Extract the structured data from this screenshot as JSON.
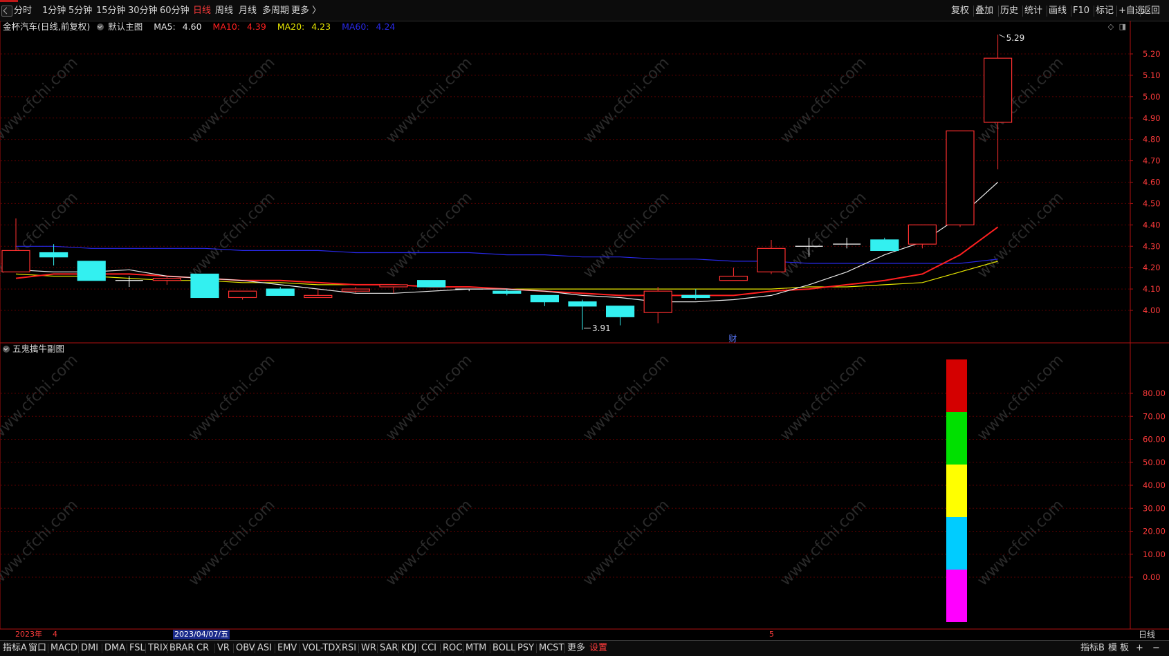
{
  "toolbar": {
    "periods": [
      {
        "label": "分时",
        "active": false
      },
      {
        "label": "1分钟",
        "active": false
      },
      {
        "label": "5分钟",
        "active": false
      },
      {
        "label": "15分钟",
        "active": false
      },
      {
        "label": "30分钟",
        "active": false
      },
      {
        "label": "60分钟",
        "active": false
      },
      {
        "label": "日线",
        "active": true
      },
      {
        "label": "周线",
        "active": false
      },
      {
        "label": "月线",
        "active": false
      },
      {
        "label": "多周期",
        "active": false
      },
      {
        "label": "更多 〉",
        "active": false
      }
    ],
    "tools": [
      "复权",
      "叠加",
      "历史",
      "统计",
      "画线",
      "F10",
      "标记",
      "+自选",
      "返回"
    ]
  },
  "main_chart": {
    "stock_name": "金杯汽车(日线,前复权)",
    "template_label": "默认主图",
    "ma5": {
      "label": "MA5:",
      "value": "4.60",
      "color": "#e8e8e8"
    },
    "ma10": {
      "label": "MA10:",
      "value": "4.39",
      "color": "#ff2020"
    },
    "ma20": {
      "label": "MA20:",
      "value": "4.23",
      "color": "#e8e800"
    },
    "ma60": {
      "label": "MA60:",
      "value": "4.24",
      "color": "#2828e8"
    },
    "high_marker": "5.29",
    "low_marker": "3.91",
    "event_marker": "财",
    "price_ticks": [
      "5.20",
      "5.10",
      "5.00",
      "4.90",
      "4.80",
      "4.70",
      "4.60",
      "4.50",
      "4.40",
      "4.30",
      "4.20",
      "4.10",
      "4.00"
    ]
  },
  "sub_chart": {
    "title": "五鬼擒牛副图",
    "ticks": [
      "80.00",
      "70.00",
      "60.00",
      "50.00",
      "40.00",
      "30.00",
      "20.00",
      "10.00",
      "0.00"
    ]
  },
  "time_axis": {
    "year_label": "2023年",
    "month_start": "4",
    "cursor_date": "2023/04/07/五",
    "month_next": "5",
    "period_label": "日线"
  },
  "bottom_tabs": {
    "indicator_a": "指标A",
    "window": "窗口",
    "indicators": [
      "MACD",
      "DMI",
      "DMA",
      "FSL",
      "TRIX",
      "BRAR",
      "CR",
      "VR",
      "OBV",
      "ASI",
      "EMV",
      "VOL-TDX",
      "RSI",
      "WR",
      "SAR",
      "KDJ",
      "CCI",
      "ROC",
      "MTM",
      "BOLL",
      "PSY",
      "MCST",
      "更多"
    ],
    "settings": "设置",
    "indicator_b": "指标B",
    "board": "模 板",
    "plus": "+",
    "minus": "−"
  },
  "watermark": "www.cfchi.com",
  "chart_data": {
    "type": "candlestick",
    "price_range": [
      3.9,
      5.3
    ],
    "candles": [
      {
        "o": 4.28,
        "h": 4.43,
        "l": 4.18,
        "c": 4.18,
        "dir": "up"
      },
      {
        "o": 4.27,
        "h": 4.31,
        "l": 4.21,
        "c": 4.25,
        "dir": "down"
      },
      {
        "o": 4.23,
        "h": 4.23,
        "l": 4.14,
        "c": 4.14,
        "dir": "down"
      },
      {
        "o": 4.14,
        "h": 4.16,
        "l": 4.11,
        "c": 4.14,
        "dir": "doji"
      },
      {
        "o": 4.14,
        "h": 4.16,
        "l": 4.12,
        "c": 4.15,
        "dir": "up"
      },
      {
        "o": 4.17,
        "h": 4.17,
        "l": 4.06,
        "c": 4.06,
        "dir": "down"
      },
      {
        "o": 4.06,
        "h": 4.09,
        "l": 4.05,
        "c": 4.09,
        "dir": "up"
      },
      {
        "o": 4.1,
        "h": 4.11,
        "l": 4.07,
        "c": 4.07,
        "dir": "down"
      },
      {
        "o": 4.06,
        "h": 4.1,
        "l": 4.06,
        "c": 4.07,
        "dir": "up"
      },
      {
        "o": 4.1,
        "h": 4.11,
        "l": 4.08,
        "c": 4.09,
        "dir": "up"
      },
      {
        "o": 4.11,
        "h": 4.12,
        "l": 4.08,
        "c": 4.12,
        "dir": "up"
      },
      {
        "o": 4.14,
        "h": 4.14,
        "l": 4.11,
        "c": 4.11,
        "dir": "down"
      },
      {
        "o": 4.1,
        "h": 4.1,
        "l": 4.09,
        "c": 4.1,
        "dir": "doji"
      },
      {
        "o": 4.09,
        "h": 4.1,
        "l": 4.07,
        "c": 4.08,
        "dir": "down"
      },
      {
        "o": 4.07,
        "h": 4.07,
        "l": 4.02,
        "c": 4.04,
        "dir": "down"
      },
      {
        "o": 4.04,
        "h": 4.05,
        "l": 3.91,
        "c": 4.02,
        "dir": "down"
      },
      {
        "o": 4.02,
        "h": 4.02,
        "l": 3.93,
        "c": 3.97,
        "dir": "down"
      },
      {
        "o": 3.99,
        "h": 4.11,
        "l": 3.94,
        "c": 4.09,
        "dir": "up"
      },
      {
        "o": 4.07,
        "h": 4.1,
        "l": 4.05,
        "c": 4.06,
        "dir": "down"
      },
      {
        "o": 4.14,
        "h": 4.2,
        "l": 4.14,
        "c": 4.16,
        "dir": "up"
      },
      {
        "o": 4.18,
        "h": 4.33,
        "l": 4.17,
        "c": 4.29,
        "dir": "up"
      },
      {
        "o": 4.3,
        "h": 4.34,
        "l": 4.25,
        "c": 4.3,
        "dir": "doji"
      },
      {
        "o": 4.31,
        "h": 4.34,
        "l": 4.29,
        "c": 4.31,
        "dir": "doji"
      },
      {
        "o": 4.33,
        "h": 4.34,
        "l": 4.28,
        "c": 4.28,
        "dir": "down"
      },
      {
        "o": 4.31,
        "h": 4.4,
        "l": 4.29,
        "c": 4.4,
        "dir": "up"
      },
      {
        "o": 4.4,
        "h": 4.84,
        "l": 4.39,
        "c": 4.84,
        "dir": "up"
      },
      {
        "o": 4.88,
        "h": 5.29,
        "l": 4.66,
        "c": 5.18,
        "dir": "up"
      }
    ],
    "ma5": [
      4.19,
      4.18,
      4.18,
      4.19,
      4.16,
      4.15,
      4.14,
      4.12,
      4.1,
      4.08,
      4.08,
      4.09,
      4.1,
      4.1,
      4.09,
      4.07,
      4.06,
      4.04,
      4.04,
      4.05,
      4.07,
      4.12,
      4.18,
      4.26,
      4.32,
      4.44,
      4.6
    ],
    "ma10": [
      4.15,
      4.17,
      4.17,
      4.17,
      4.16,
      4.15,
      4.14,
      4.14,
      4.13,
      4.12,
      4.12,
      4.11,
      4.11,
      4.1,
      4.09,
      4.08,
      4.07,
      4.07,
      4.07,
      4.07,
      4.09,
      4.1,
      4.12,
      4.14,
      4.17,
      4.26,
      4.39
    ],
    "ma20": [
      4.17,
      4.16,
      4.16,
      4.15,
      4.14,
      4.14,
      4.13,
      4.13,
      4.12,
      4.12,
      4.12,
      4.11,
      4.11,
      4.1,
      4.1,
      4.1,
      4.1,
      4.1,
      4.1,
      4.1,
      4.1,
      4.11,
      4.11,
      4.12,
      4.13,
      4.18,
      4.23
    ],
    "ma60": [
      4.3,
      4.3,
      4.29,
      4.29,
      4.29,
      4.29,
      4.28,
      4.28,
      4.28,
      4.27,
      4.27,
      4.27,
      4.27,
      4.26,
      4.26,
      4.25,
      4.25,
      4.24,
      4.24,
      4.23,
      4.23,
      4.22,
      4.22,
      4.22,
      4.22,
      4.22,
      4.24
    ],
    "sub_bars": [
      {
        "from": 80,
        "to": 100,
        "color": "#d40000"
      },
      {
        "from": 60,
        "to": 80,
        "color": "#00e000"
      },
      {
        "from": 40,
        "to": 60,
        "color": "#ffff00"
      },
      {
        "from": 20,
        "to": 40,
        "color": "#00ccff"
      },
      {
        "from": 0,
        "to": 20,
        "color": "#ff00ff"
      }
    ]
  }
}
